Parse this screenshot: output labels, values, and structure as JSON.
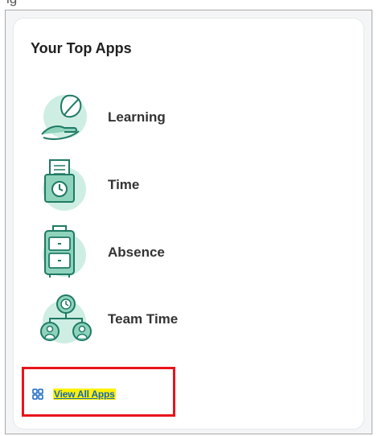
{
  "header": {
    "cropped_text": "ig"
  },
  "card": {
    "title": "Your Top Apps",
    "apps": [
      {
        "label": "Learning",
        "icon": "learning-leaf-hand-icon"
      },
      {
        "label": "Time",
        "icon": "time-clock-card-icon"
      },
      {
        "label": "Absence",
        "icon": "absence-luggage-icon"
      },
      {
        "label": "Team Time",
        "icon": "team-time-clock-people-icon"
      }
    ],
    "view_all_label": "View All Apps",
    "view_all_icon": "grid-apps-icon"
  },
  "colors": {
    "icon_bg": "#cfeee3",
    "icon_stroke": "#1e7a64",
    "icon_fill": "#8fd3bd",
    "link": "#1565c0",
    "link_highlight": "#fff200",
    "annotation_box": "#e8151a"
  }
}
